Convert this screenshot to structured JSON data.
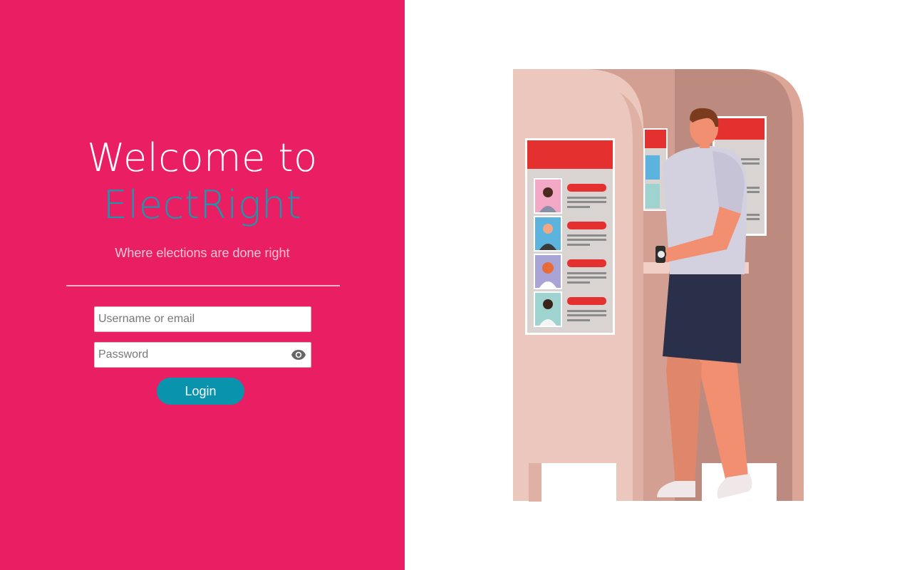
{
  "welcome": {
    "line1": "Welcome to",
    "line2": "ElectRight",
    "tagline": "Where elections are done right"
  },
  "form": {
    "username_placeholder": "Username or email",
    "password_placeholder": "Password",
    "login_label": "Login"
  },
  "icons": {
    "password_toggle": "eye-icon"
  },
  "colors": {
    "brand_pink": "#e91e63",
    "accent_teal": "#0a93ad",
    "title_teal": "#1a98ad"
  }
}
